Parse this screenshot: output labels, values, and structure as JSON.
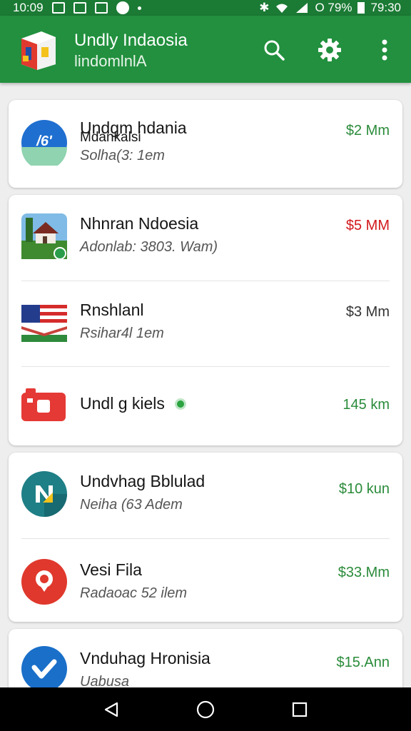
{
  "status_bar": {
    "time_left": "10:09",
    "battery_text": "O 79%",
    "time_right": "79:30"
  },
  "app_bar": {
    "title": "Undly Indaosia",
    "subtitle": "lindomlnlA",
    "icons": [
      "search-icon",
      "settings-icon",
      "more-vert-icon"
    ]
  },
  "items": [
    {
      "title": "Undgm hdania",
      "overlap": "Mdankalsi",
      "subtitle": "Solha(3: 1em",
      "price": "$2 Mm",
      "price_color": "#2a8b3a",
      "icon": "blue-circle-logo-icon"
    },
    {
      "title": "Nhnran Ndoesia",
      "subtitle": "Adonlab: 3803. Wam)",
      "price": "$5 MM",
      "price_color": "#d3181c",
      "icon": "house-photo-icon"
    },
    {
      "title": "Rnshlanl",
      "subtitle": "Rsihar4l 1em",
      "price": "$3 Mm",
      "price_color": "#333333",
      "icon": "flag-icon"
    },
    {
      "title": "Undl g kiels",
      "subtitle": "",
      "price": "145 km",
      "price_color": "#2a8b3a",
      "icon": "red-camera-icon"
    },
    {
      "title": "Undvhag Bblulad",
      "subtitle": "Neiha (63 Adem",
      "price": "$10 kun",
      "price_color": "#2a8b3a",
      "icon": "teal-n-logo-icon"
    },
    {
      "title": "Vesi Fila",
      "subtitle": "Radaoac 52 ilem",
      "price": "$33.Mm",
      "price_color": "#2a8b3a",
      "icon": "red-pin-icon"
    },
    {
      "title": "Vnduhag Hronisia",
      "subtitle": "Uabusa",
      "price": "$15.Ann",
      "price_color": "#2a8b3a",
      "icon": "blue-check-icon"
    }
  ]
}
